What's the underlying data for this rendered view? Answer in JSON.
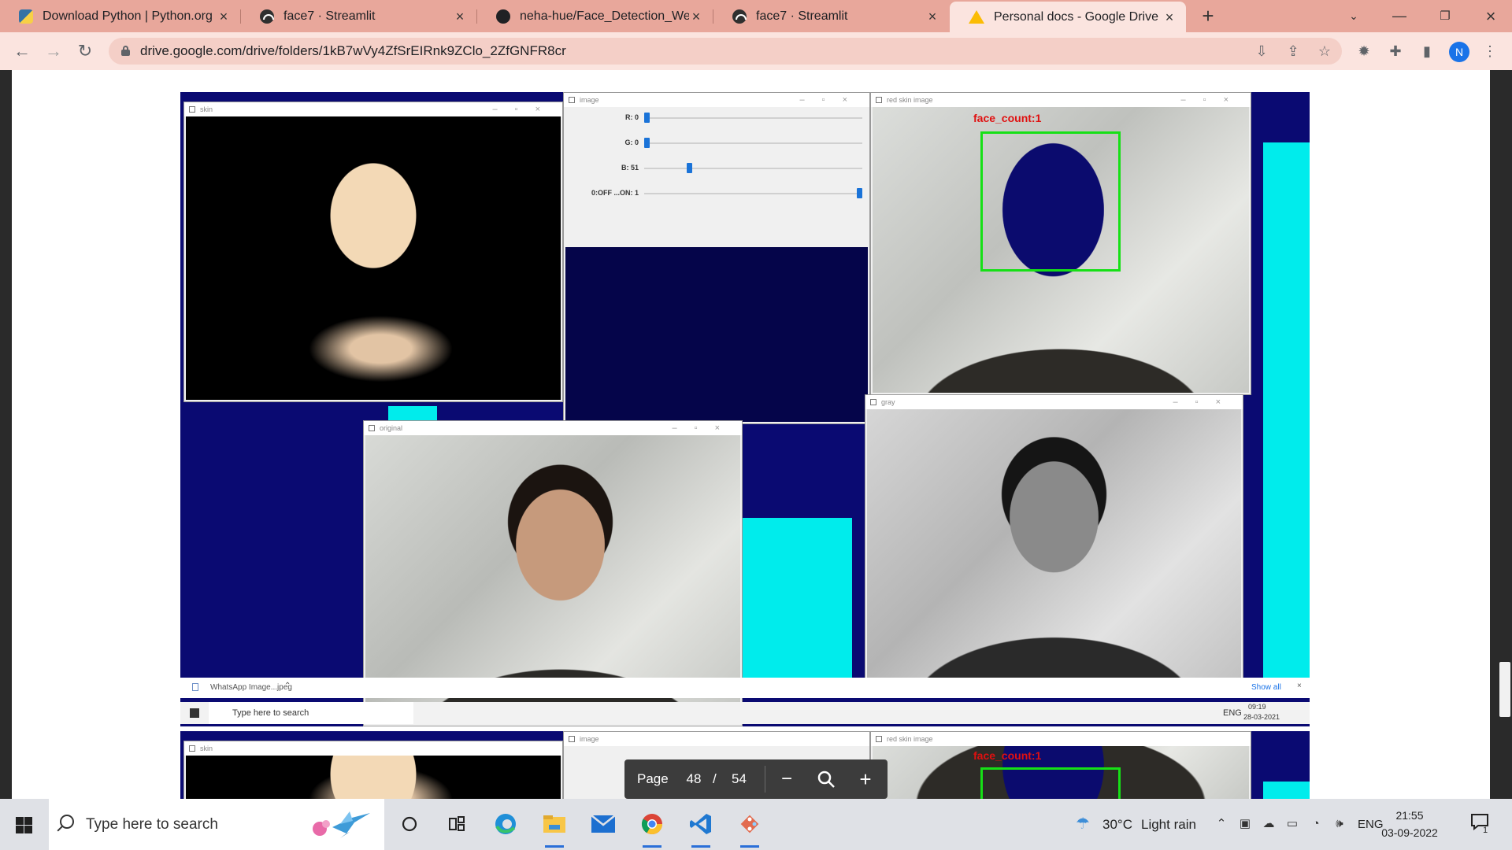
{
  "browser": {
    "tabs": [
      {
        "title": "Download Python | Python.org",
        "active": false,
        "favicon": "python-favicon"
      },
      {
        "title": "face7 · Streamlit",
        "active": false,
        "favicon": "streamlit-favicon"
      },
      {
        "title": "neha-hue/Face_Detection_WebApp",
        "active": false,
        "favicon": "github-favicon"
      },
      {
        "title": "face7 · Streamlit",
        "active": false,
        "favicon": "streamlit-favicon"
      },
      {
        "title": "Personal docs - Google Drive",
        "active": true,
        "favicon": "google-drive-favicon"
      }
    ],
    "url": "drive.google.com/drive/folders/1kB7wVy4ZfSrEIRnk9ZClo_2ZfGNFR8cr",
    "profile_initial": "N",
    "accent": "#1a73e8",
    "tab_strip_color": "#e8a79b"
  },
  "pdf_viewer": {
    "page_label": "Page",
    "current_page": "48",
    "separator": "/",
    "total_pages": "54",
    "zoom_out_icon": "minus-icon",
    "zoom_icon": "magnifier-icon",
    "zoom_in_icon": "plus-icon"
  },
  "page_image": {
    "windows": {
      "skin": "skin",
      "image": "image",
      "red_skin": "red skin image",
      "original": "original",
      "gray": "gray"
    },
    "trackbars": [
      {
        "label": "R: 0",
        "level": 0.0
      },
      {
        "label": "G: 0",
        "level": 0.0
      },
      {
        "label": "B: 51",
        "level": 0.2
      },
      {
        "label": "0:OFF ...ON: 1",
        "level": 1.0
      }
    ],
    "face_count_text": "face_count:1",
    "mini_taskbar": {
      "search_placeholder": "Type here to search",
      "time": "09:19",
      "date": "28-03-2021",
      "lang": "ENG"
    },
    "download_bar": {
      "file": "WhatsApp Image...jpeg",
      "show_all": "Show all"
    }
  },
  "taskbar": {
    "search_placeholder": "Type here to search",
    "weather_temp": "30°C",
    "weather_text": "Light rain",
    "language": "ENG",
    "time": "21:55",
    "date": "03-09-2022",
    "notification_count": "1"
  }
}
